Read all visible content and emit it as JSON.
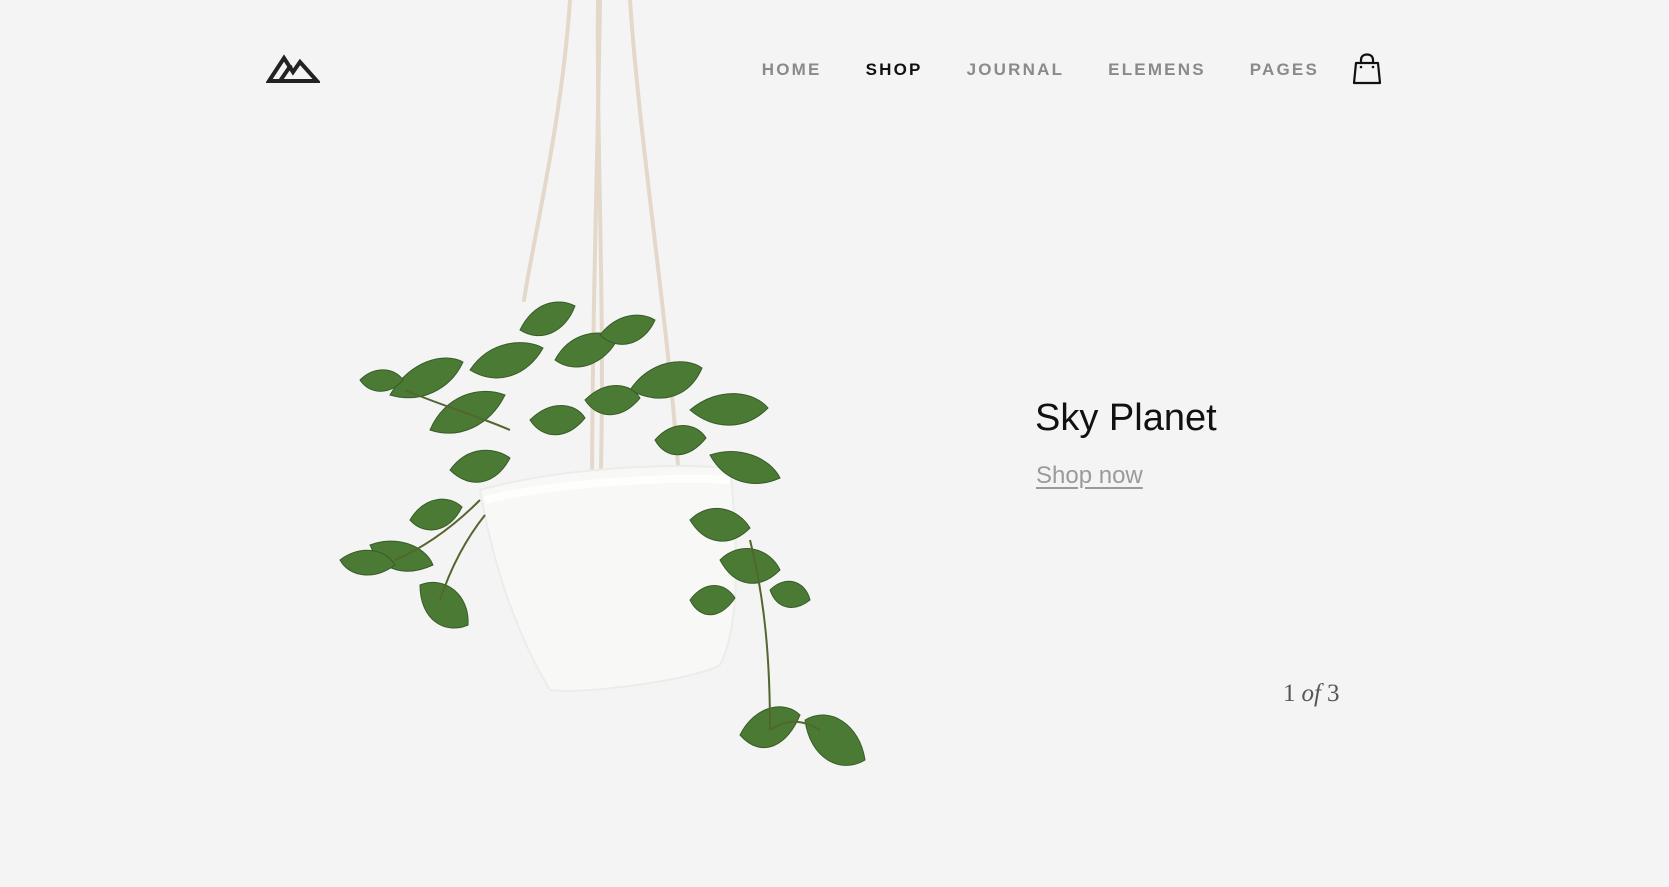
{
  "nav": {
    "items": [
      {
        "label": "HOME",
        "active": false
      },
      {
        "label": "SHOP",
        "active": true
      },
      {
        "label": "JOURNAL",
        "active": false
      },
      {
        "label": "ELEMENS",
        "active": false
      },
      {
        "label": "PAGES",
        "active": false
      }
    ]
  },
  "icons": {
    "logo": "mountain-logo-icon",
    "cart": "shopping-bag-icon"
  },
  "slide": {
    "title": "Sky Planet",
    "cta": "Shop now",
    "current": "1",
    "of": "of",
    "total": "3"
  },
  "colors": {
    "background": "#f4f4f4",
    "text": "#111111",
    "muted": "#8a8a8a",
    "leaf": "#3f6b2f",
    "pot": "#f8f8f6",
    "rope": "#e7ddd1"
  }
}
